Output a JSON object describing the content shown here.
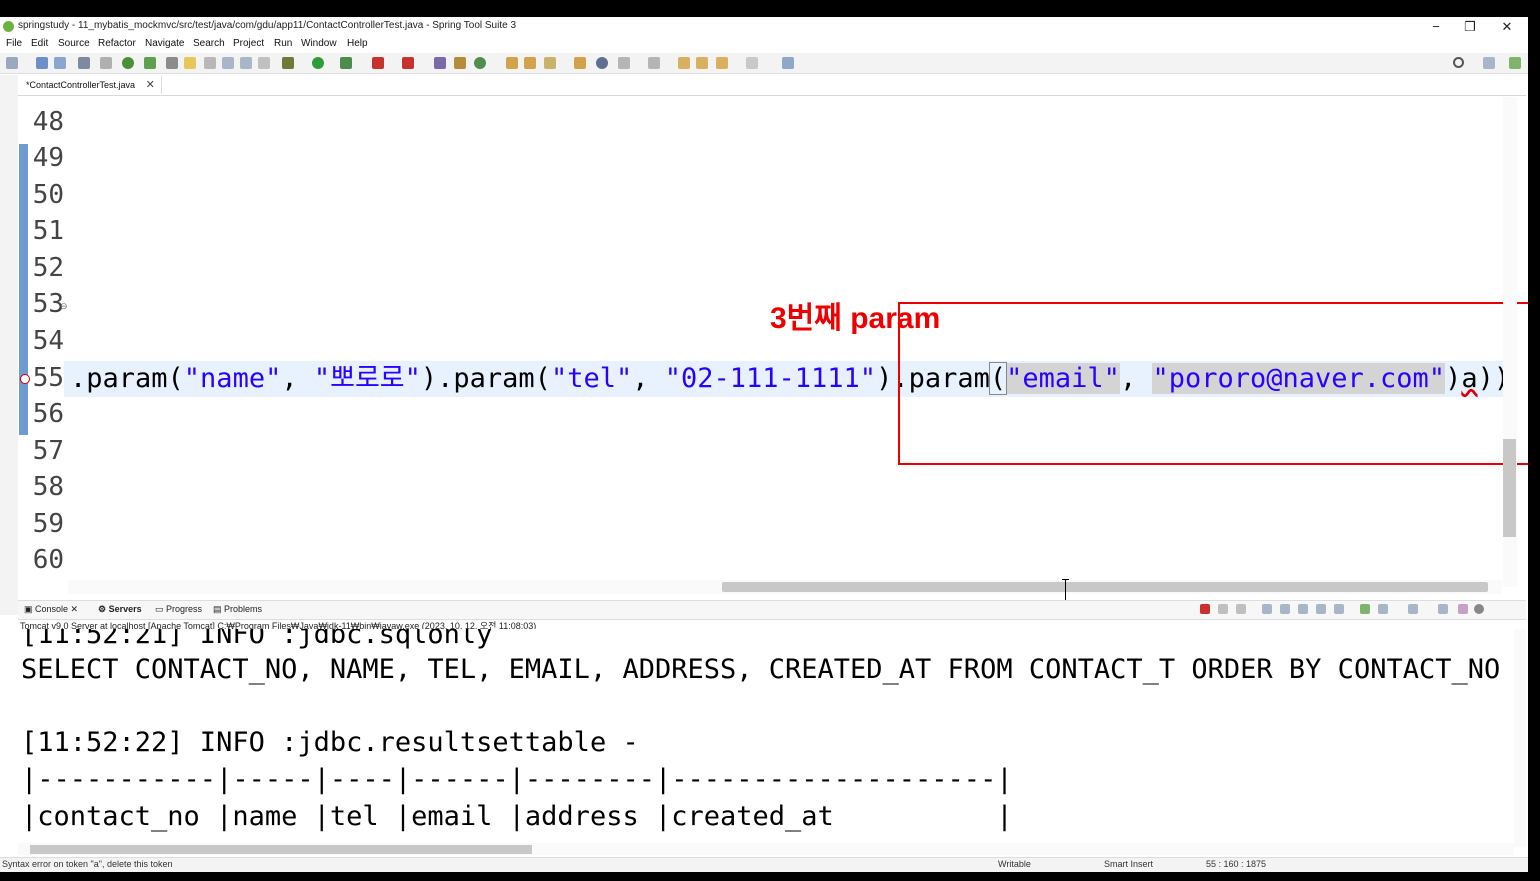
{
  "window": {
    "title": "springstudy - 11_mybatis_mockmvc/src/test/java/com/gdu/app11/ContactControllerTest.java - Spring Tool Suite 3",
    "controls": {
      "minimize": "−",
      "restore": "❐",
      "close": "✕"
    }
  },
  "menu": [
    "File",
    "Edit",
    "Source",
    "Refactor",
    "Navigate",
    "Search",
    "Project",
    "Run",
    "Window",
    "Help"
  ],
  "editor": {
    "tab_label": "*ContactControllerTest.java",
    "tab_close": "✕",
    "line_numbers": [
      "48",
      "49",
      "50",
      "51",
      "52",
      "53",
      "54",
      "55",
      "56",
      "57",
      "58",
      "59",
      "60"
    ],
    "code_line": {
      "p1": ".param(",
      "s1": "\"name\"",
      "p2": ", ",
      "s2": "\"뽀로로\"",
      "p3": ").param(",
      "s3": "\"tel\"",
      "p4": ", ",
      "s4": "\"02-111-1111\"",
      "p5": ")",
      "p6": ".param",
      "p7": "(",
      "s5": "\"email\"",
      "p8": ", ",
      "s6": "\"pororo@naver.com\"",
      "p9": ")",
      "p10": "a",
      "p11": "))"
    }
  },
  "annotation": {
    "text": "3번째 param",
    "color": "#ee0000"
  },
  "bottom_tabs": [
    "Console",
    "Servers",
    "Progress",
    "Problems"
  ],
  "console": {
    "info": "Tomcat v9.0 Server at localhost [Apache Tomcat] C:₩Program Files₩Java₩jdk-11₩bin₩javaw.exe  (2023. 10. 12. 오전 11:08:03)",
    "lines": [
      "[11:52:21] INFO :jdbc.sqlonly",
      "SELECT CONTACT_NO, NAME, TEL, EMAIL, ADDRESS, CREATED_AT FROM CONTACT_T ORDER BY CONTACT_NO AS",
      "",
      "[11:52:22] INFO :jdbc.resultsettable -",
      "|-----------|-----|----|------|--------|--------------------|",
      "|contact_no |name |tel |email |address |created_at          |"
    ]
  },
  "status": {
    "message": "Syntax error on token \"a\", delete this token",
    "mode": "Writable",
    "insert": "Smart Insert",
    "position": "55 : 160 : 1875"
  },
  "colors": {
    "string": "#2a00ff",
    "highlight_line": "#e8f2fe",
    "brand": "#6db33f"
  }
}
